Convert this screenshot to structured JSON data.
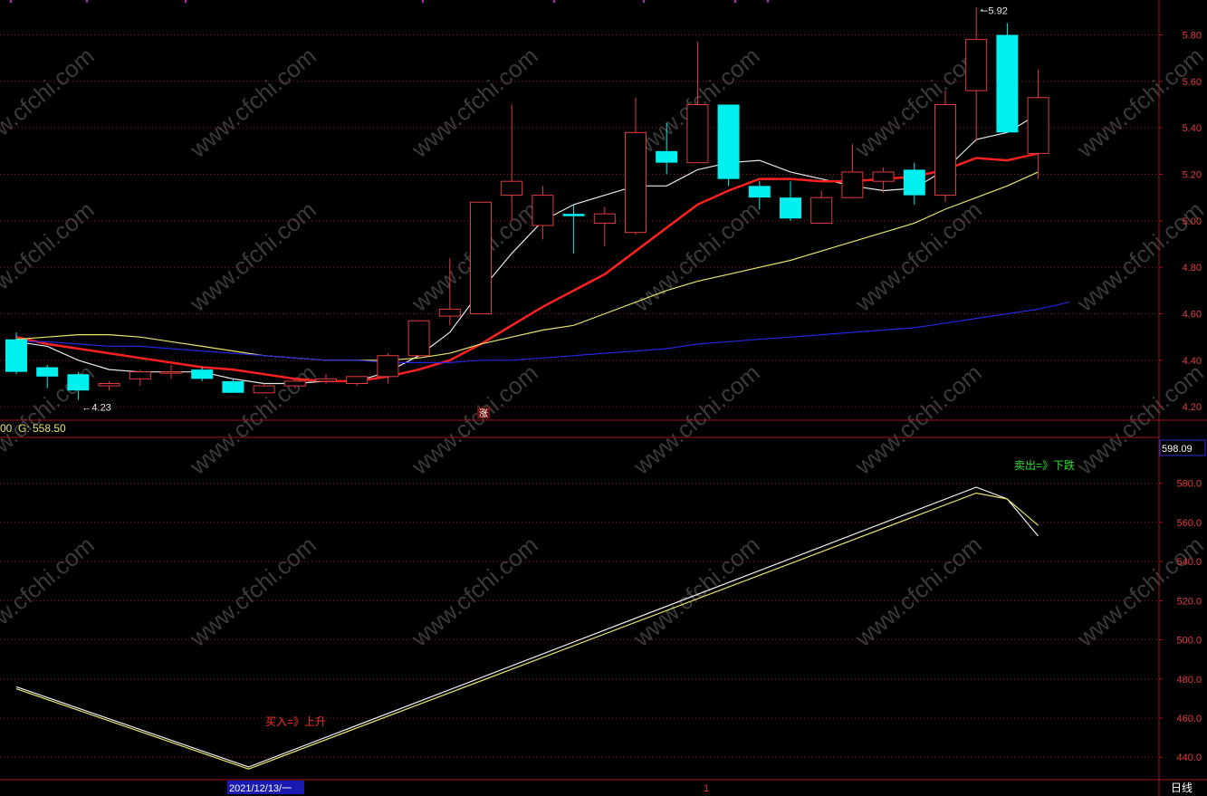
{
  "colors": {
    "background": "#000000",
    "up": "#e03c3c",
    "down": "#00f0f0",
    "frame": "#a01818",
    "grid": "#8c1414",
    "axis_text": "#e03c3c",
    "ma_white": "#e8e8e8",
    "ma_red": "#ff2020",
    "ma_yellow": "#e6e46a",
    "ma_blue": "#2626e0",
    "ind_white": "#f0f0f0",
    "ind_yellow": "#e6e46a",
    "buy_text": "#ff3030",
    "sell_text": "#30e030",
    "header_text": "#e6e46a",
    "watermark": "#3a3a3a"
  },
  "header": {
    "left_fragment": "00",
    "g_label": "G: 558.50"
  },
  "watermark_text": "www.cfchi.com",
  "limit_up_marker": "涨",
  "period_label": "日线",
  "date_cursor": "2021/12/13/一",
  "month_marker": "1",
  "chart_data": [
    {
      "type": "candlestick",
      "title": "",
      "ylim": [
        4.15,
        5.95
      ],
      "ytick_labels": [
        "5.80",
        "5.60",
        "5.40",
        "5.20",
        "5.00",
        "4.80",
        "4.60",
        "4.40",
        "4.20"
      ],
      "yticks": [
        5.8,
        5.6,
        5.4,
        5.2,
        5.0,
        4.8,
        4.6,
        4.4,
        4.2
      ],
      "candles": [
        {
          "o": 4.49,
          "h": 4.52,
          "l": 4.34,
          "c": 4.35
        },
        {
          "o": 4.37,
          "h": 4.38,
          "l": 4.28,
          "c": 4.33
        },
        {
          "o": 4.34,
          "h": 4.35,
          "l": 4.23,
          "c": 4.27
        },
        {
          "o": 4.29,
          "h": 4.31,
          "l": 4.27,
          "c": 4.3
        },
        {
          "o": 4.32,
          "h": 4.36,
          "l": 4.29,
          "c": 4.35
        },
        {
          "o": 4.35,
          "h": 4.38,
          "l": 4.32,
          "c": 4.35
        },
        {
          "o": 4.36,
          "h": 4.37,
          "l": 4.31,
          "c": 4.32
        },
        {
          "o": 4.31,
          "h": 4.32,
          "l": 4.26,
          "c": 4.26
        },
        {
          "o": 4.26,
          "h": 4.3,
          "l": 4.26,
          "c": 4.29
        },
        {
          "o": 4.29,
          "h": 4.32,
          "l": 4.28,
          "c": 4.31
        },
        {
          "o": 4.31,
          "h": 4.34,
          "l": 4.3,
          "c": 4.32
        },
        {
          "o": 4.3,
          "h": 4.33,
          "l": 4.29,
          "c": 4.33
        },
        {
          "o": 4.33,
          "h": 4.43,
          "l": 4.3,
          "c": 4.42
        },
        {
          "o": 4.42,
          "h": 4.57,
          "l": 4.41,
          "c": 4.57
        },
        {
          "o": 4.59,
          "h": 4.84,
          "l": 4.55,
          "c": 4.62
        },
        {
          "o": 4.6,
          "h": 5.08,
          "l": 4.6,
          "c": 5.08
        },
        {
          "o": 5.11,
          "h": 5.5,
          "l": 5.0,
          "c": 5.17
        },
        {
          "o": 4.98,
          "h": 5.15,
          "l": 4.92,
          "c": 5.11
        },
        {
          "o": 5.03,
          "h": 5.07,
          "l": 4.86,
          "c": 5.02
        },
        {
          "o": 4.99,
          "h": 5.06,
          "l": 4.89,
          "c": 5.03
        },
        {
          "o": 4.95,
          "h": 5.53,
          "l": 4.94,
          "c": 5.38
        },
        {
          "o": 5.3,
          "h": 5.42,
          "l": 5.2,
          "c": 5.25
        },
        {
          "o": 5.25,
          "h": 5.77,
          "l": 5.25,
          "c": 5.5
        },
        {
          "o": 5.5,
          "h": 5.5,
          "l": 5.15,
          "c": 5.18
        },
        {
          "o": 5.15,
          "h": 5.17,
          "l": 5.05,
          "c": 5.1
        },
        {
          "o": 5.1,
          "h": 5.17,
          "l": 5.0,
          "c": 5.01
        },
        {
          "o": 4.99,
          "h": 5.13,
          "l": 4.99,
          "c": 5.1
        },
        {
          "o": 5.1,
          "h": 5.33,
          "l": 5.1,
          "c": 5.21
        },
        {
          "o": 5.17,
          "h": 5.23,
          "l": 5.12,
          "c": 5.21
        },
        {
          "o": 5.22,
          "h": 5.25,
          "l": 5.07,
          "c": 5.11
        },
        {
          "o": 5.11,
          "h": 5.56,
          "l": 5.08,
          "c": 5.5
        },
        {
          "o": 5.56,
          "h": 5.92,
          "l": 5.34,
          "c": 5.78
        },
        {
          "o": 5.8,
          "h": 5.85,
          "l": 5.38,
          "c": 5.38
        },
        {
          "o": 5.29,
          "h": 5.65,
          "l": 5.18,
          "c": 5.53
        }
      ],
      "annotations": [
        {
          "text": "4.23",
          "candle": 2,
          "value": 4.23
        },
        {
          "text": "5.92",
          "candle": 31,
          "value": 5.92
        }
      ],
      "series": [
        {
          "color_key": "ma_white",
          "values": [
            4.48,
            4.46,
            4.4,
            4.36,
            4.35,
            4.35,
            4.35,
            4.32,
            4.3,
            4.3,
            4.31,
            4.31,
            4.35,
            4.42,
            4.52,
            4.7,
            4.86,
            5.0,
            5.07,
            5.11,
            5.15,
            5.15,
            5.22,
            5.25,
            5.26,
            5.21,
            5.18,
            5.15,
            5.13,
            5.14,
            5.22,
            5.35,
            5.38,
            5.46
          ]
        },
        {
          "color_key": "ma_red",
          "values": [
            4.5,
            4.47,
            4.45,
            4.43,
            4.41,
            4.39,
            4.37,
            4.36,
            4.34,
            4.32,
            4.31,
            4.31,
            4.33,
            4.36,
            4.4,
            4.47,
            4.55,
            4.63,
            4.7,
            4.77,
            4.87,
            4.97,
            5.07,
            5.13,
            5.18,
            5.18,
            5.17,
            5.17,
            5.18,
            5.19,
            5.22,
            5.27,
            5.26,
            5.29
          ]
        },
        {
          "color_key": "ma_yellow",
          "values": [
            4.49,
            4.5,
            4.51,
            4.51,
            4.5,
            4.48,
            4.46,
            4.44,
            4.42,
            4.41,
            4.4,
            4.4,
            4.4,
            4.41,
            4.43,
            4.47,
            4.5,
            4.53,
            4.55,
            4.6,
            4.65,
            4.7,
            4.74,
            4.77,
            4.8,
            4.83,
            4.87,
            4.91,
            4.95,
            4.99,
            5.05,
            5.1,
            5.15,
            5.21
          ]
        },
        {
          "color_key": "ma_blue",
          "values": [
            4.48,
            4.48,
            4.47,
            4.46,
            4.46,
            4.45,
            4.44,
            4.43,
            4.42,
            4.41,
            4.4,
            4.4,
            4.39,
            4.39,
            4.39,
            4.4,
            4.4,
            4.41,
            4.42,
            4.43,
            4.44,
            4.45,
            4.47,
            4.48,
            4.49,
            4.5,
            4.51,
            4.52,
            4.53,
            4.54,
            4.56,
            4.58,
            4.6,
            4.62,
            4.65
          ]
        }
      ]
    },
    {
      "type": "line",
      "title": "",
      "ylim": [
        429,
        603
      ],
      "ytick_labels": [
        "580.0",
        "560.0",
        "540.0",
        "520.0",
        "500.0",
        "480.0",
        "460.0",
        "440.0"
      ],
      "yticks": [
        580,
        560,
        540,
        520,
        500,
        480,
        460,
        440
      ],
      "current_value_label": "598.09",
      "buy_label": "买入=》上升",
      "sell_label": "卖出=》下跌",
      "series": [
        {
          "color_key": "ind_white",
          "points": [
            [
              0,
              476.0
            ],
            [
              7.5,
              435.0
            ],
            [
              31.0,
              578.0
            ],
            [
              32.0,
              572.0
            ],
            [
              33.0,
              553.0
            ]
          ]
        },
        {
          "color_key": "ind_yellow",
          "points": [
            [
              0,
              475.0
            ],
            [
              7.5,
              434.0
            ],
            [
              31.0,
              575.0
            ],
            [
              32.0,
              572.0
            ],
            [
              33.0,
              558.5
            ]
          ]
        }
      ]
    }
  ]
}
